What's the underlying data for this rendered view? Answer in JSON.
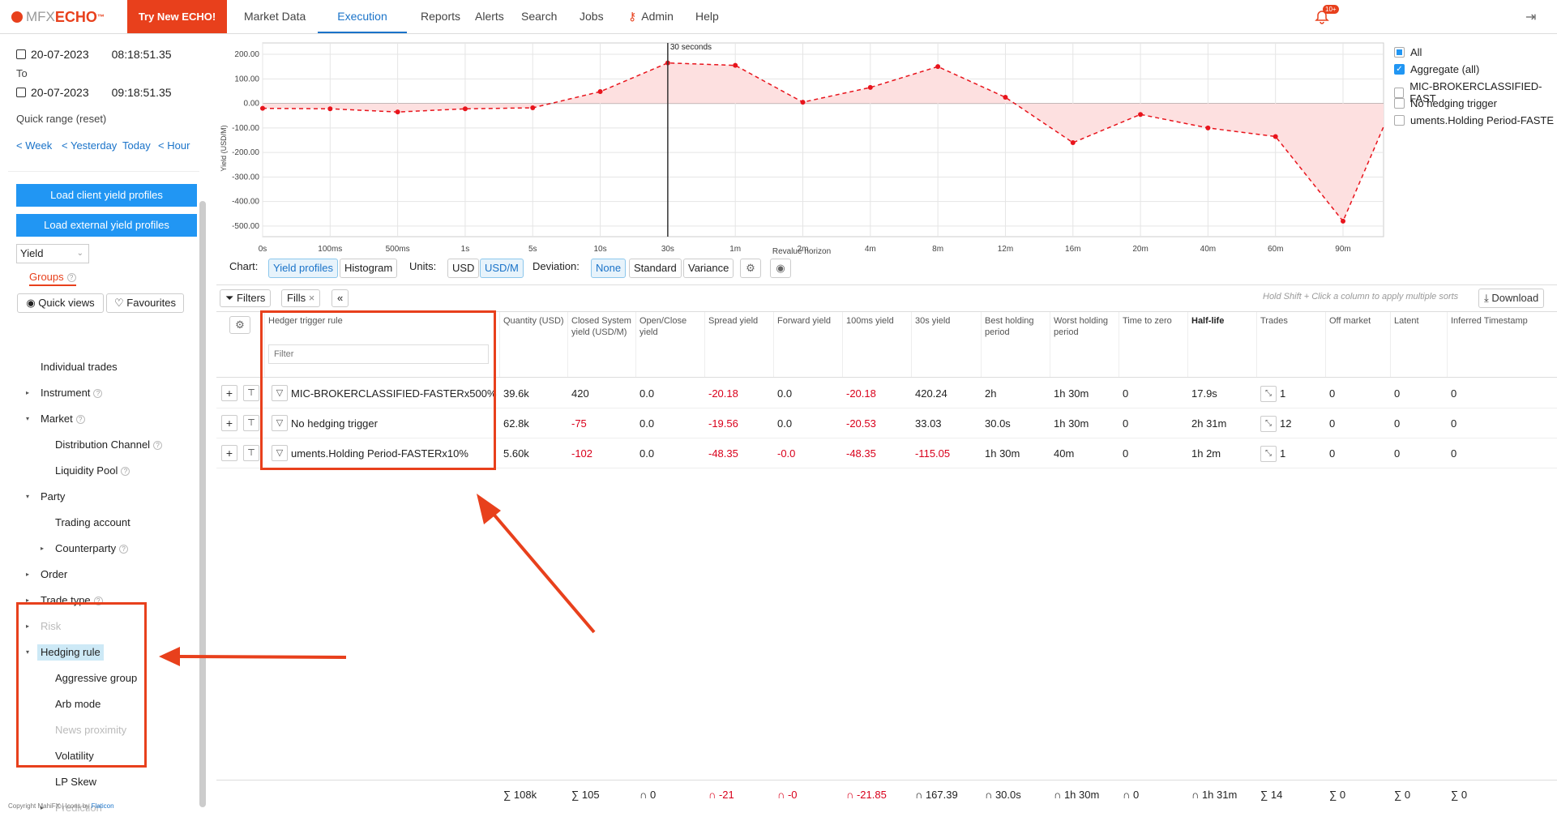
{
  "header": {
    "logo_brand": "MFX",
    "logo_product": "ECHO",
    "logo_tm": "™",
    "try_button": "Try New ECHO!",
    "nav": [
      "Market Data",
      "Execution",
      "Reports",
      "Alerts",
      "Search",
      "Jobs",
      "Admin",
      "Help"
    ],
    "active_nav": "Execution",
    "notification_badge": "10+"
  },
  "sidebar": {
    "from_date": "20-07-2023",
    "from_time": "08:18:51.35",
    "to_label": "To",
    "to_date": "20-07-2023",
    "to_time": "09:18:51.35",
    "quick_range": "Quick range (reset)",
    "range_links": [
      "Week",
      "Yesterday",
      "Today",
      "Hour"
    ],
    "load_client": "Load client yield profiles",
    "load_external": "Load external yield profiles",
    "metric_select": "Yield",
    "groups_tab": "Groups",
    "quick_views": "Quick views",
    "favourites": "Favourites",
    "tree": [
      {
        "label": "Individual trades",
        "level": 0,
        "toggle": "",
        "help": false,
        "disabled": false
      },
      {
        "label": "Instrument",
        "level": 0,
        "toggle": "▸",
        "help": true,
        "disabled": false
      },
      {
        "label": "Market",
        "level": 0,
        "toggle": "▾",
        "help": true,
        "disabled": false
      },
      {
        "label": "Distribution Channel",
        "level": 1,
        "toggle": "",
        "help": true,
        "disabled": false
      },
      {
        "label": "Liquidity Pool",
        "level": 1,
        "toggle": "",
        "help": true,
        "disabled": false
      },
      {
        "label": "Party",
        "level": 0,
        "toggle": "▾",
        "help": false,
        "disabled": false
      },
      {
        "label": "Trading account",
        "level": 1,
        "toggle": "",
        "help": false,
        "disabled": false
      },
      {
        "label": "Counterparty",
        "level": 1,
        "toggle": "▸",
        "help": true,
        "disabled": false
      },
      {
        "label": "Order",
        "level": 0,
        "toggle": "▸",
        "help": false,
        "disabled": false
      },
      {
        "label": "Trade type",
        "level": 0,
        "toggle": "▸",
        "help": true,
        "disabled": false
      },
      {
        "label": "Risk",
        "level": 0,
        "toggle": "▸",
        "help": false,
        "disabled": true
      },
      {
        "label": "Hedging rule",
        "level": 0,
        "toggle": "▾",
        "help": false,
        "disabled": false,
        "selected": true
      },
      {
        "label": "Aggressive group",
        "level": 1,
        "toggle": "",
        "help": false,
        "disabled": false
      },
      {
        "label": "Arb mode",
        "level": 1,
        "toggle": "",
        "help": false,
        "disabled": false
      },
      {
        "label": "News proximity",
        "level": 1,
        "toggle": "",
        "help": false,
        "disabled": true
      },
      {
        "label": "Volatility",
        "level": 1,
        "toggle": "",
        "help": false,
        "disabled": false
      },
      {
        "label": "LP Skew",
        "level": 1,
        "toggle": "",
        "help": false,
        "disabled": false
      },
      {
        "label": "Prediction",
        "level": 1,
        "toggle": "▸",
        "help": false,
        "disabled": true
      }
    ],
    "copyright": "Copyright MahiFX | Icons by ",
    "copyright_link": "Flaticon"
  },
  "chart_data": {
    "type": "area",
    "categories": [
      "0s",
      "100ms",
      "500ms",
      "1s",
      "5s",
      "10s",
      "30s",
      "1m",
      "2m",
      "4m",
      "8m",
      "12m",
      "16m",
      "20m",
      "40m",
      "60m",
      "90m"
    ],
    "values": [
      -20,
      -22,
      -35,
      -22,
      -18,
      48,
      165,
      155,
      5,
      65,
      150,
      25,
      -160,
      -45,
      -100,
      -135,
      -480,
      -95
    ],
    "ylabel": "Yield (USD/M)",
    "xlabel": "Revalue horizon",
    "yticks": [
      "200.00",
      "100.00",
      "0.00",
      "-100.00",
      "-200.00",
      "-300.00",
      "-400.00",
      "-500.00"
    ],
    "ylim": [
      -530,
      220
    ],
    "cursor_label": "30 seconds",
    "cursor_category": "30s",
    "color": "#e8141c",
    "fill": "#fde0e0"
  },
  "legend": {
    "items": [
      {
        "label": "All",
        "state": "partial"
      },
      {
        "label": "Aggregate (all)",
        "state": "checked"
      },
      {
        "label": "MIC-BROKERCLASSIFIED-FAST",
        "state": "unchecked"
      },
      {
        "label": "No hedging trigger",
        "state": "unchecked"
      },
      {
        "label": "uments.Holding Period-FASTE",
        "state": "unchecked"
      }
    ]
  },
  "controls": {
    "chart_label": "Chart:",
    "chart_options": [
      "Yield profiles",
      "Histogram"
    ],
    "units_label": "Units:",
    "unit_options": [
      "USD",
      "USD/M"
    ],
    "deviation_label": "Deviation:",
    "deviation_options": [
      "None",
      "Standard",
      "Variance"
    ]
  },
  "filter_bar": {
    "filters": "Filters",
    "fills": "Fills",
    "hint": "Hold Shift + Click a column to apply multiple sorts",
    "download": "Download"
  },
  "table": {
    "columns": [
      {
        "key": "rule",
        "label": "Hedger trigger rule",
        "bold": false
      },
      {
        "key": "qty",
        "label": "Quantity (USD)",
        "bold": false
      },
      {
        "key": "closed",
        "label": "Closed System yield (USD/M)",
        "bold": false
      },
      {
        "key": "openclose",
        "label": "Open/Close yield",
        "bold": false
      },
      {
        "key": "spread",
        "label": "Spread yield",
        "bold": false
      },
      {
        "key": "forward",
        "label": "Forward yield",
        "bold": false
      },
      {
        "key": "y100",
        "label": "100ms yield",
        "bold": false
      },
      {
        "key": "y30",
        "label": "30s yield",
        "bold": false
      },
      {
        "key": "best",
        "label": "Best holding period",
        "bold": false
      },
      {
        "key": "worst",
        "label": "Worst holding period",
        "bold": false
      },
      {
        "key": "ttz",
        "label": "Time to zero",
        "bold": false
      },
      {
        "key": "half",
        "label": "Half-life",
        "bold": true
      },
      {
        "key": "trades",
        "label": "Trades",
        "bold": false
      },
      {
        "key": "offmkt",
        "label": "Off market",
        "bold": false
      },
      {
        "key": "latent",
        "label": "Latent",
        "bold": false
      },
      {
        "key": "inferred",
        "label": "Inferred Timestamp",
        "bold": false
      }
    ],
    "filter_placeholder": "Filter",
    "rows": [
      {
        "rule": "MIC-BROKERCLASSIFIED-FASTERx500%",
        "qty": "39.6k",
        "closed": "420",
        "openclose": "0.0",
        "spread": "-20.18",
        "forward": "0.0",
        "y100": "-20.18",
        "y30": "420.24",
        "best": "2h",
        "worst": "1h 30m",
        "ttz": "0",
        "half": "17.9s",
        "trades": "1",
        "offmkt": "0",
        "latent": "0",
        "inferred": "0"
      },
      {
        "rule": "No hedging trigger",
        "qty": "62.8k",
        "closed": "-75",
        "openclose": "0.0",
        "spread": "-19.56",
        "forward": "0.0",
        "y100": "-20.53",
        "y30": "33.03",
        "best": "30.0s",
        "worst": "1h 30m",
        "ttz": "0",
        "half": "2h 31m",
        "trades": "12",
        "offmkt": "0",
        "latent": "0",
        "inferred": "0"
      },
      {
        "rule": "uments.Holding Period-FASTERx10%",
        "qty": "5.60k",
        "closed": "-102",
        "openclose": "0.0",
        "spread": "-48.35",
        "forward": "-0.0",
        "y100": "-48.35",
        "y30": "-115.05",
        "best": "1h 30m",
        "worst": "40m",
        "ttz": "0",
        "half": "1h 2m",
        "trades": "1",
        "offmkt": "0",
        "latent": "0",
        "inferred": "0"
      }
    ],
    "footer": {
      "qty": "∑ 108k",
      "closed": "∑ 105",
      "openclose": "∩ 0",
      "spread": "∩ -21",
      "forward": "∩ -0",
      "y100": "∩ -21.85",
      "y30": "∩ 167.39",
      "best": "∩ 30.0s",
      "worst": "∩ 1h 30m",
      "ttz": "∩ 0",
      "half": "∩ 1h 31m",
      "trades": "∑ 14",
      "offmkt": "∑ 0",
      "latent": "∑ 0",
      "inferred": "∑ 0"
    }
  }
}
